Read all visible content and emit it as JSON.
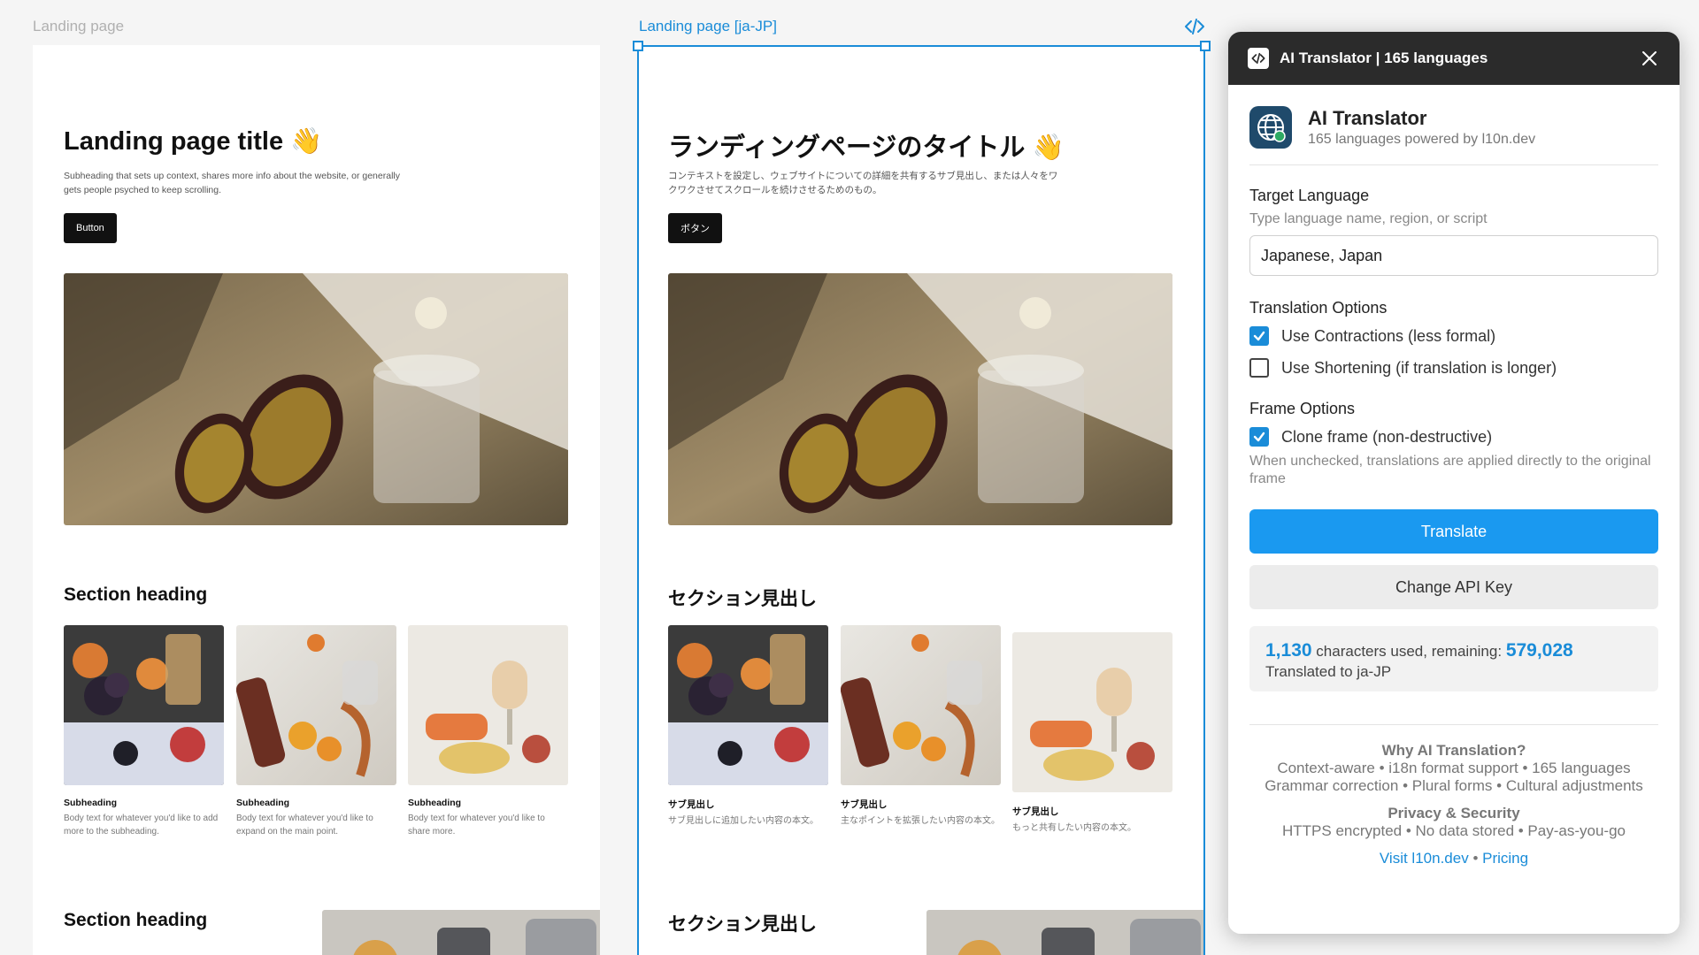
{
  "canvas": {
    "left_frame_label": "Landing page",
    "right_frame_label": "Landing page [ja-JP]"
  },
  "original_page": {
    "title": "Landing page title 👋",
    "subheading": "Subheading that sets up context, shares more info about the website, or generally gets people psyched to keep scrolling.",
    "button": "Button",
    "section_heading": "Section heading",
    "cards": [
      {
        "title": "Subheading",
        "body": "Body text for whatever you'd like to add more to the subheading."
      },
      {
        "title": "Subheading",
        "body": "Body text for whatever you'd like to expand on the main point."
      },
      {
        "title": "Subheading",
        "body": "Body text for whatever you'd like to share more."
      }
    ],
    "section_heading_2": "Section heading"
  },
  "translated_page": {
    "title": "ランディングページのタイトル 👋",
    "subheading": "コンテキストを設定し、ウェブサイトについての詳細を共有するサブ見出し、または人々をワクワクさせてスクロールを続けさせるためのもの。",
    "button": "ボタン",
    "section_heading": "セクション見出し",
    "cards": [
      {
        "title": "サブ見出し",
        "body": "サブ見出しに追加したい内容の本文。"
      },
      {
        "title": "サブ見出し",
        "body": "主なポイントを拡張したい内容の本文。"
      },
      {
        "title": "サブ見出し",
        "body": "もっと共有したい内容の本文。"
      }
    ],
    "section_heading_2": "セクション見出し"
  },
  "plugin": {
    "header_title": "AI Translator | 165 languages",
    "app_name": "AI Translator",
    "app_desc": "165 languages powered by l10n.dev",
    "target_language_label": "Target Language",
    "target_language_hint": "Type language name, region, or script",
    "target_language_value": "Japanese, Japan",
    "translation_options_label": "Translation Options",
    "opt_contractions": "Use Contractions (less formal)",
    "opt_contractions_checked": true,
    "opt_shortening": "Use Shortening (if translation is longer)",
    "opt_shortening_checked": false,
    "frame_options_label": "Frame Options",
    "opt_clone": "Clone frame (non-destructive)",
    "opt_clone_checked": true,
    "clone_note": "When unchecked, translations are applied directly to the original frame",
    "translate_button": "Translate",
    "api_key_button": "Change API Key",
    "chars_used": "1,130",
    "chars_used_text": "characters used, remaining:",
    "chars_remaining": "579,028",
    "translated_to": "Translated to ja-JP",
    "why_heading": "Why AI Translation?",
    "why_line1": "Context-aware • i18n format support • 165 languages",
    "why_line2": "Grammar correction • Plural forms • Cultural adjustments",
    "privacy_heading": "Privacy & Security",
    "privacy_line": "HTTPS encrypted • No data stored • Pay-as-you-go",
    "link_visit": "Visit l10n.dev",
    "link_sep": "•",
    "link_pricing": "Pricing"
  },
  "colors": {
    "accent": "#1a8cd8",
    "primary_button": "#1a99f0",
    "panel_header": "#2b2b2b"
  }
}
